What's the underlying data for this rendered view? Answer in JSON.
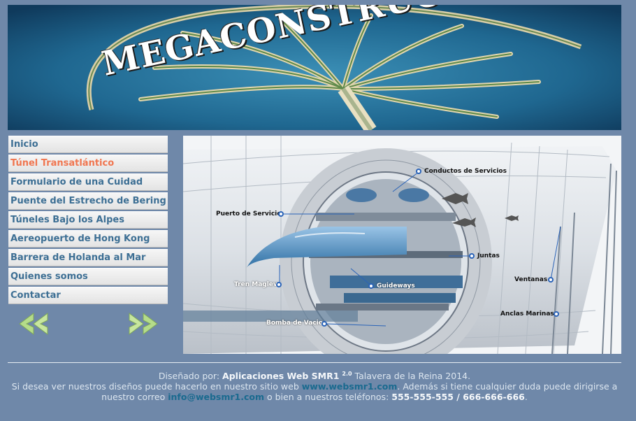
{
  "banner": {
    "title": "MEGACONSTRUCCIONES"
  },
  "menu": {
    "items": [
      {
        "label": "Inicio"
      },
      {
        "label": "Túnel Transatlántico"
      },
      {
        "label": "Formulario de una Cuidad"
      },
      {
        "label": "Puente del Estrecho de Bering"
      },
      {
        "label": "Túneles Bajo los Alpes"
      },
      {
        "label": "Aereopuerto de Hong Kong"
      },
      {
        "label": "Barrera de Holanda al Mar"
      },
      {
        "label": "Quienes somos"
      },
      {
        "label": "Contactar"
      }
    ],
    "active_index": 1,
    "colors": {
      "normal": "#3d6f94",
      "active": "#f07650"
    }
  },
  "navigation": {
    "prev_icon": "double-chevron-left-icon",
    "next_icon": "double-chevron-right-icon"
  },
  "figure": {
    "labels": {
      "conductos": "Conductos de Servicios",
      "puerto": "Puerto de Servicio",
      "juntas": "Juntas",
      "ventanas": "Ventanas",
      "tren": "Tren Maglev",
      "guideways": "Guideways",
      "anclas": "Anclas Marinas",
      "bomba": "Bomba de Vacio"
    }
  },
  "footer": {
    "designed_by_prefix": "Diseñado por: ",
    "designer": "Aplicaciones Web SMR1",
    "version": "2.0",
    "designed_suffix": " Talavera de la Reina 2014.",
    "line2_prefix": "Si desea ver nuestros diseños puede hacerlo en nuestro sitio web ",
    "website": "www.websmr1.com",
    "line2_suffix": ". Además si tiene cualquier duda puede dirigirse a",
    "line3_prefix": "nuestro correo ",
    "email": "info@websmr1.com",
    "line3_mid": " o bien a nuestros teléfonos: ",
    "phones": "555-555-555 / 666-666-666",
    "line3_end": "."
  }
}
